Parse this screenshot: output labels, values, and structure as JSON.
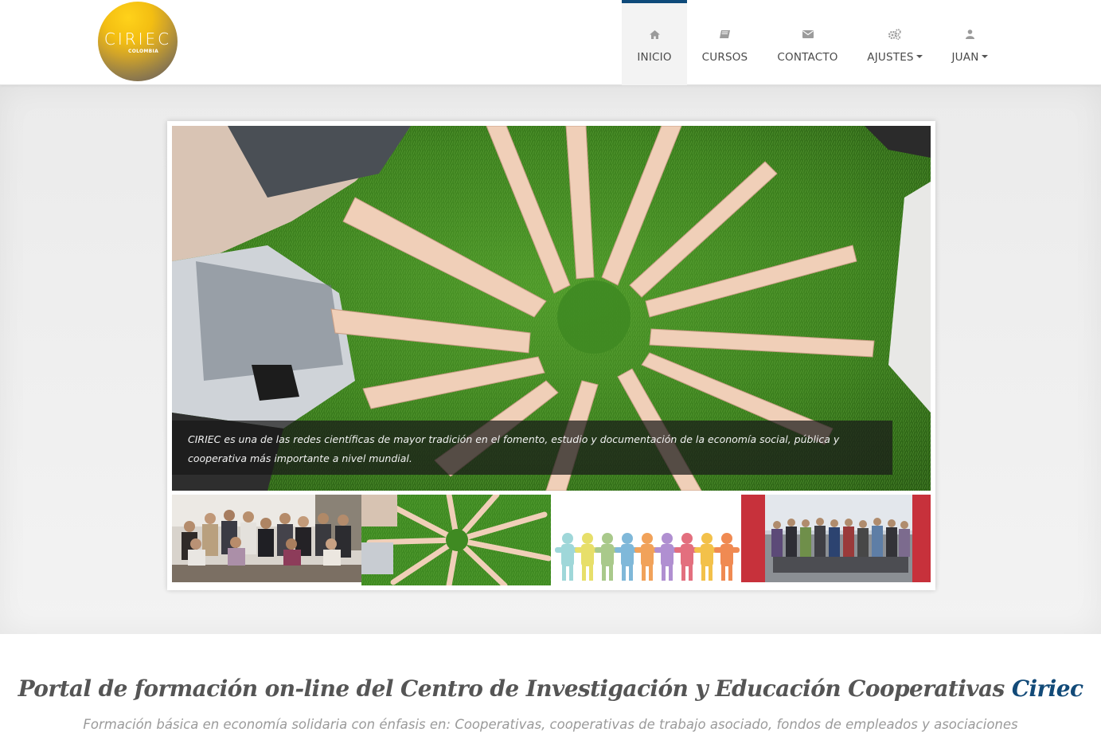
{
  "logo": {
    "main": "CIRIEC",
    "sub": "COLOMBIA"
  },
  "nav": {
    "items": [
      {
        "label": "INICIO",
        "icon": "home-icon",
        "active": true
      },
      {
        "label": "CURSOS",
        "icon": "book-icon"
      },
      {
        "label": "CONTACTO",
        "icon": "envelope-icon"
      },
      {
        "label": "AJUSTES",
        "icon": "cogs-icon",
        "dropdown": true
      },
      {
        "label": "JUAN",
        "icon": "user-icon",
        "dropdown": true
      }
    ],
    "active_color": "#0e4a7a"
  },
  "carousel": {
    "caption": "CIRIEC es una de las redes científicas de mayor tradición en el fomento, estudio y documentación de la economía social, pública y cooperativa más importante a nivel mundial.",
    "thumbnails": [
      "group-photo-meeting",
      "hands-and-feet-on-grass",
      "paper-people-chain",
      "group-photo-ferry"
    ]
  },
  "intro": {
    "title": "Portal de formación on-line del Centro de Investigación y Educación Cooperativas",
    "title_accent": "Ciriec",
    "subtitle": "Formación básica en economía solidaria con énfasis en: Cooperativas, cooperativas de trabajo asociado, fondos de empleados y asociaciones"
  }
}
